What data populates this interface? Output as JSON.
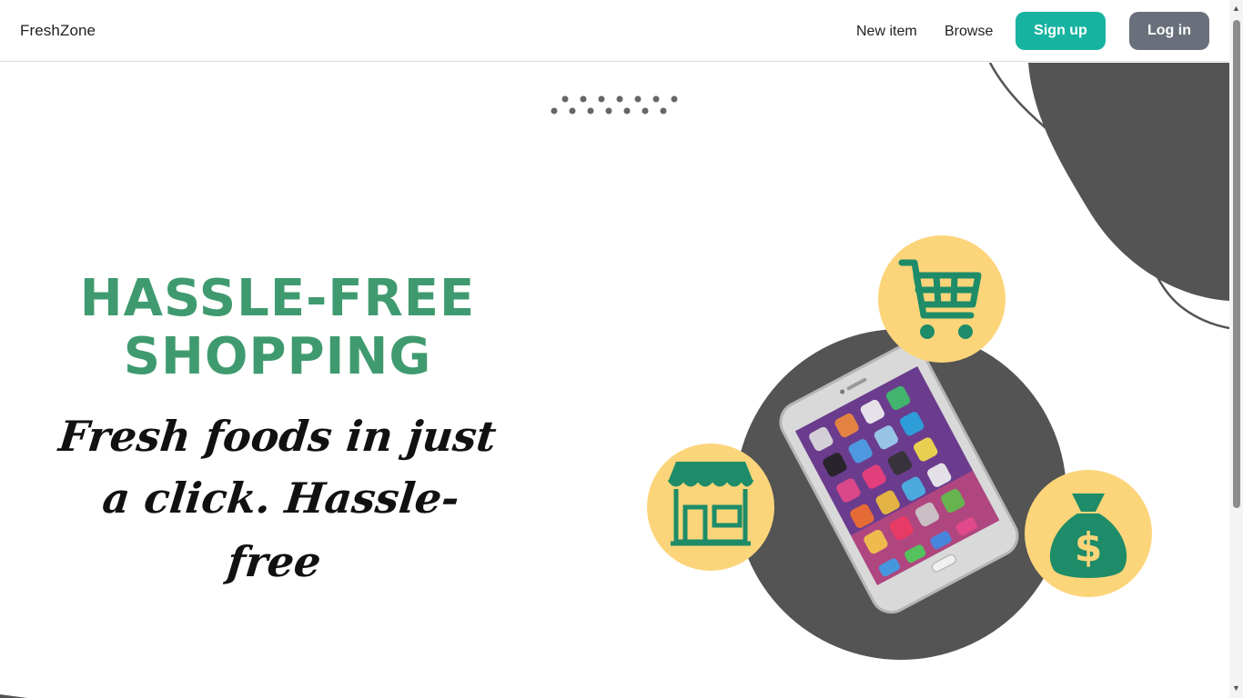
{
  "navbar": {
    "brand": "FreshZone",
    "links": [
      "New item",
      "Browse"
    ],
    "signup_label": "Sign up",
    "login_label": "Log in"
  },
  "hero": {
    "headline_line1": "HASSLE-FREE",
    "headline_line2": "SHOPPING",
    "script_line1": "Fresh foods in just",
    "script_line2": "a click. Hassle-free",
    "icons": [
      "shopping-cart-icon",
      "storefront-icon",
      "money-bag-icon",
      "smartphone-illustration"
    ]
  },
  "colors": {
    "brand_green": "#3f9b6f",
    "teal_button": "#17b3a0",
    "gray_button": "#6a707b",
    "dark_blob": "#545454",
    "icon_circle": "#fcd57a",
    "icon_green": "#1e8c68"
  }
}
